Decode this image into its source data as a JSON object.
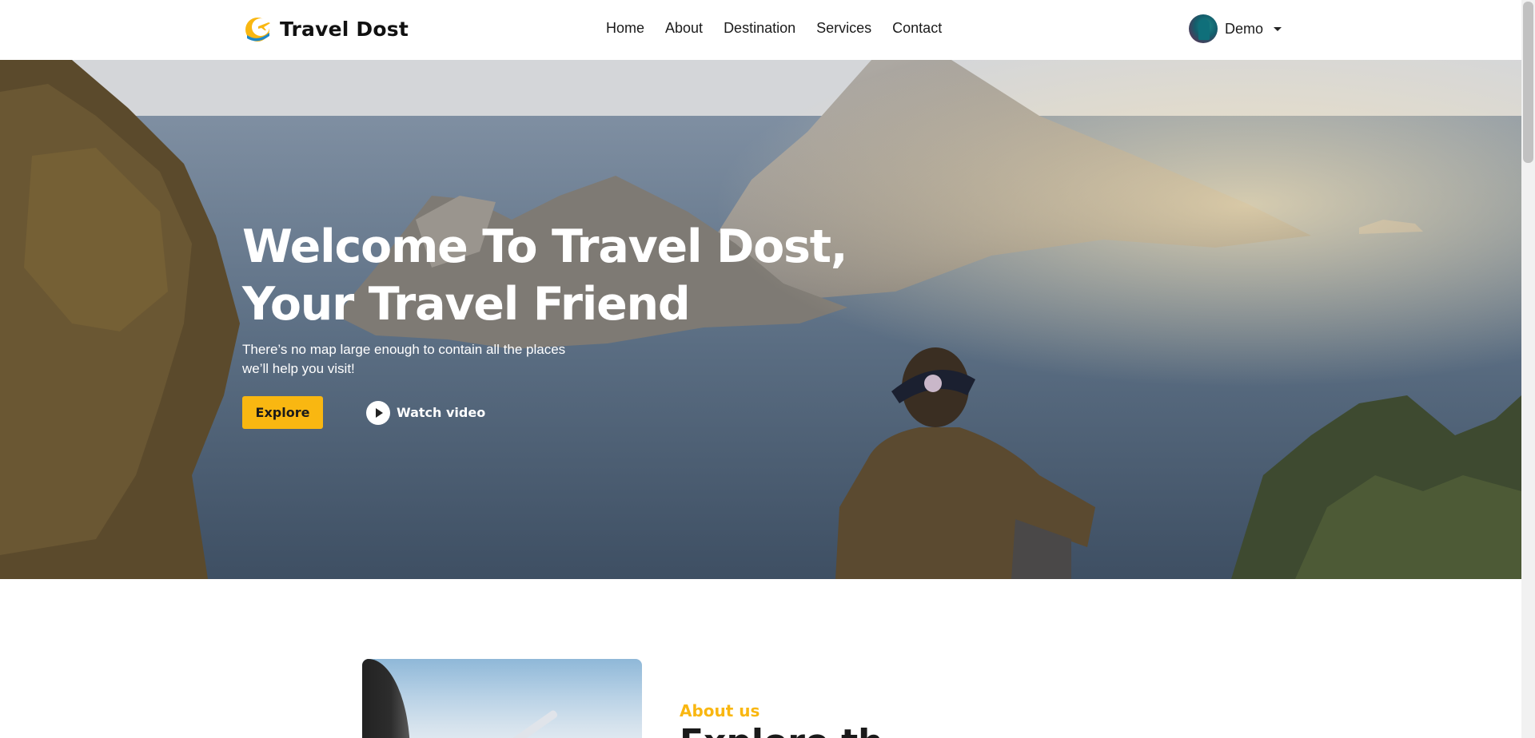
{
  "brand": {
    "name": "Travel Dost",
    "accent_color": "#f9b711",
    "logo_icon": "sun-plane-logo-icon"
  },
  "nav": {
    "items": [
      {
        "label": "Home"
      },
      {
        "label": "About"
      },
      {
        "label": "Destination"
      },
      {
        "label": "Services"
      },
      {
        "label": "Contact"
      }
    ]
  },
  "user": {
    "name": "Demo",
    "avatar_icon": "user-avatar",
    "dropdown_icon": "caret-down-icon"
  },
  "hero": {
    "title_line1": "Welcome To Travel Dost,",
    "title_line2": "Your Travel Friend",
    "subtitle_line1": "There’s no map large enough to contain all the places",
    "subtitle_line2": "we’ll help you visit!",
    "explore_label": "Explore",
    "watch_label": "Watch video",
    "watch_icon": "play-icon",
    "button_color": "#f9b711"
  },
  "about": {
    "label": "About us",
    "heading": "Explore th"
  }
}
